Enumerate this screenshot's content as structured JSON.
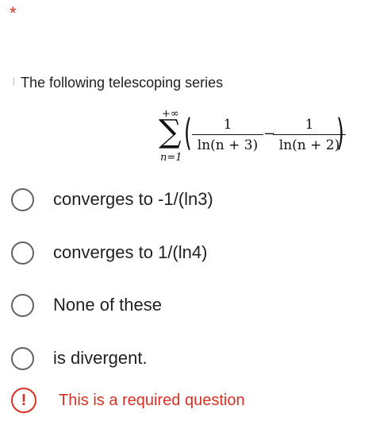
{
  "required_marker": "*",
  "question": {
    "text": "The following telescoping series",
    "formula": {
      "sum_upper": "+∞",
      "sum_symbol": "∑",
      "sum_lower": "n=1",
      "term1_numerator": "1",
      "term1_denominator": "ln(n + 3)",
      "operator": "−",
      "term2_numerator": "1",
      "term2_denominator": "ln(n + 2)"
    }
  },
  "options": [
    {
      "label": "converges to -1/(ln3)"
    },
    {
      "label": "converges to 1/(ln4)"
    },
    {
      "label": "None of these"
    },
    {
      "label": "is divergent."
    }
  ],
  "error": {
    "icon": "!",
    "message": "This is a required question"
  },
  "colors": {
    "error": "#d93025",
    "radio_border": "#5f6368"
  }
}
